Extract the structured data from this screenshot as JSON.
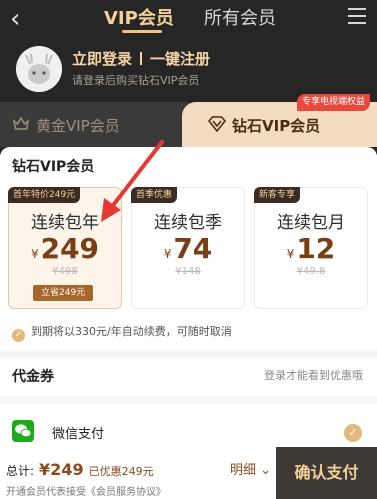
{
  "header": {
    "back_glyph": "‹",
    "tabs": [
      {
        "label": "VIP会员"
      },
      {
        "label": "所有会员"
      }
    ]
  },
  "profile": {
    "login_label": "立即登录",
    "register_label": "一键注册",
    "hint": "请登录后购买钻石VIP会员"
  },
  "membership_tabs": [
    {
      "label": "黄金VIP会员"
    },
    {
      "label": "钻石VIP会员",
      "badge": "专享电视端权益"
    }
  ],
  "section_title": "钻石VIP会员",
  "plans": [
    {
      "tag": "首年特价249元",
      "name": "连续包年",
      "currency": "¥",
      "price": "249",
      "original": "¥498",
      "save": "立省249元"
    },
    {
      "tag": "首季优惠",
      "name": "连续包季",
      "currency": "¥",
      "price": "74",
      "original": "¥148"
    },
    {
      "tag": "新客专享",
      "name": "连续包月",
      "currency": "¥",
      "price": "12",
      "original": "¥49.8"
    }
  ],
  "renew_note": "到期将以330元/年自动续费，可随时取消",
  "voucher": {
    "title": "代金券",
    "hint": "登录才能看到优惠哦"
  },
  "payment": {
    "method": "微信支付"
  },
  "footer": {
    "total_label": "总计:",
    "total_amount": "¥249",
    "discount": "已优惠249元",
    "detail_label": "明细",
    "agreement": "开通会员代表接受《会员服务协议》",
    "confirm_label": "确认支付"
  },
  "colors": {
    "accent": "#7a3e14",
    "gold": "#f3d29a",
    "arrow": "#e53935",
    "wechat": "#1aad19"
  }
}
